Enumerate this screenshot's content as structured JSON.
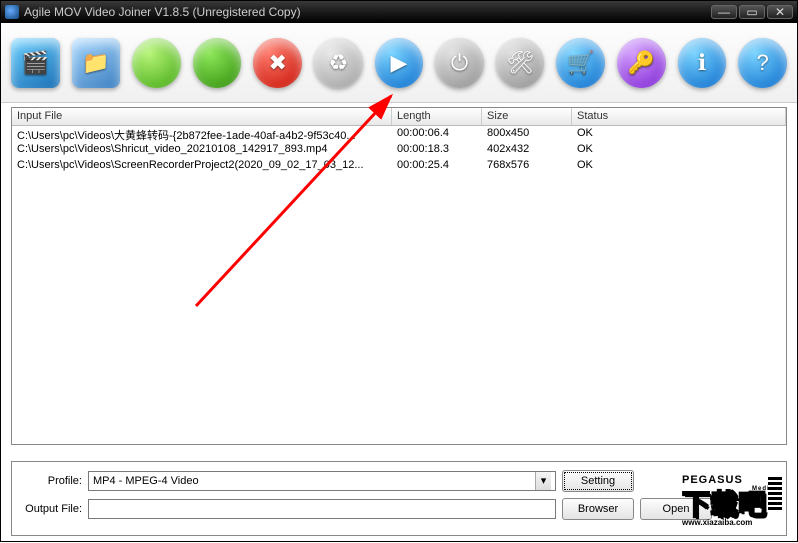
{
  "window": {
    "title": "Agile MOV Video Joiner V1.8.5 (Unregistered Copy)"
  },
  "toolbar": [
    {
      "name": "add-file-icon",
      "bg": "linear-gradient(150deg,#6bd0ff,#1a6fb5)",
      "glyph": "🎬"
    },
    {
      "name": "add-folder-icon",
      "bg": "linear-gradient(150deg,#a8d8ff,#3b7fc0)",
      "glyph": "📁"
    },
    {
      "name": "move-up-icon",
      "bg": "radial-gradient(circle at 35% 30%,#b8f57a,#3ea50e)",
      "glyph": ""
    },
    {
      "name": "move-down-icon",
      "bg": "radial-gradient(circle at 35% 30%,#8ee85a,#2c8a06)",
      "glyph": ""
    },
    {
      "name": "remove-icon",
      "bg": "radial-gradient(circle at 35% 30%,#ff7a6b,#c40d00)",
      "glyph": "✖"
    },
    {
      "name": "clear-icon",
      "bg": "radial-gradient(circle at 35% 30%,#e8e8e8,#9a9a9a)",
      "glyph": "♻"
    },
    {
      "name": "play-icon",
      "bg": "radial-gradient(circle at 35% 30%,#7ad4ff,#0567c9)",
      "glyph": "▶"
    },
    {
      "name": "power-icon",
      "bg": "radial-gradient(circle at 35% 30%,#e0e0e0,#8a8a8a)",
      "glyph": "⏻"
    },
    {
      "name": "settings-icon",
      "bg": "radial-gradient(circle at 35% 30%,#e0e0e0,#8a8a8a)",
      "glyph": "🛠"
    },
    {
      "name": "buy-icon",
      "bg": "radial-gradient(circle at 35% 30%,#7ad4ff,#0567c9)",
      "glyph": "🛒"
    },
    {
      "name": "register-icon",
      "bg": "radial-gradient(circle at 35% 30%,#d29bff,#7a1fd0)",
      "glyph": "🔑"
    },
    {
      "name": "about-icon",
      "bg": "radial-gradient(circle at 35% 30%,#7ad4ff,#0567c9)",
      "glyph": "ℹ"
    },
    {
      "name": "help-icon",
      "bg": "radial-gradient(circle at 35% 30%,#7ad4ff,#0567c9)",
      "glyph": "?"
    }
  ],
  "columns": {
    "file": "Input File",
    "length": "Length",
    "size": "Size",
    "status": "Status"
  },
  "files": [
    {
      "path": "C:\\Users\\pc\\Videos\\大黄蜂转码-{2b872fee-1ade-40af-a4b2-9f53c40...",
      "length": "00:00:06.4",
      "size": "800x450",
      "status": "OK"
    },
    {
      "path": "C:\\Users\\pc\\Videos\\Shricut_video_20210108_142917_893.mp4",
      "length": "00:00:18.3",
      "size": "402x432",
      "status": "OK"
    },
    {
      "path": "C:\\Users\\pc\\Videos\\ScreenRecorderProject2(2020_09_02_17_03_12...",
      "length": "00:00:25.4",
      "size": "768x576",
      "status": "OK"
    }
  ],
  "form": {
    "profile_label": "Profile:",
    "profile_value": "MP4 - MPEG-4 Video",
    "outputfile_label": "Output File:",
    "outputfile_value": "",
    "setting_btn": "Setting",
    "browser_btn": "Browser",
    "open_btn": "Open"
  },
  "logo": {
    "brand": "PEGASUS",
    "sub": "Media",
    "big": "下载吧",
    "url": "www.xiazaiba.com"
  }
}
